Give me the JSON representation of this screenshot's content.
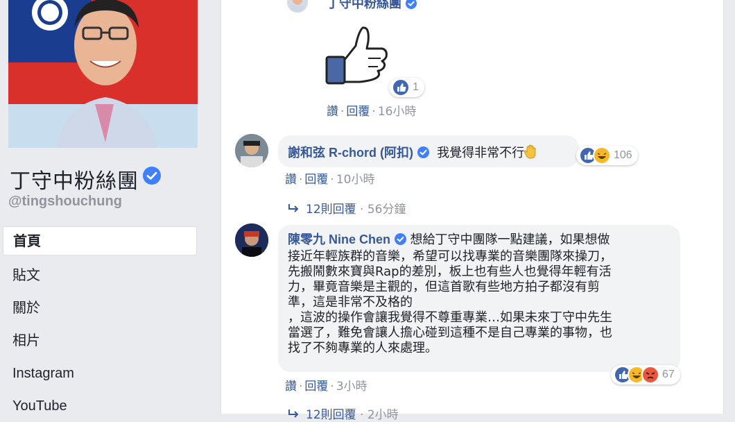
{
  "page": {
    "name": "丁守中粉絲團",
    "handle": "@tingshouchung"
  },
  "nav": {
    "items": [
      {
        "label": "首頁",
        "active": true
      },
      {
        "label": "貼文"
      },
      {
        "label": "關於"
      },
      {
        "label": "相片"
      },
      {
        "label": "Instagram"
      },
      {
        "label": "YouTube"
      }
    ]
  },
  "comments": {
    "top": {
      "author": "丁守中粉絲團",
      "sticker": "thumbs-up-sticker",
      "reaction_count": "1",
      "like": "讚",
      "reply": "回覆",
      "time": "16小時"
    },
    "c1": {
      "author": "謝和弦 R-chord (阿扣)",
      "text": "我覺得非常不行",
      "reaction_count": "106",
      "like": "讚",
      "reply": "回覆",
      "time": "10小時",
      "replies": "12則回覆",
      "replies_time": "56分鐘"
    },
    "c2": {
      "author": "陳零九 Nine Chen",
      "lines": [
        "想給丁守中團隊一點建議，如果想做",
        "接近年輕族群的音樂，希望可以找專業的音樂團隊來操刀，",
        "先搬鬧數來寶與Rap的差別，板上也有些人也覺得年輕有活",
        "力，畢竟音樂是主觀的，但這首歌有些地方拍子都沒有剪",
        "準，這是非常不及格的",
        "，這波的操作會讓我覺得不尊重專業…如果未來丁守中先生",
        "當選了，難免會讓人擔心碰到這種不是自己專業的事物，也",
        "找了不夠專業的人來處理。"
      ],
      "reaction_count": "67",
      "like": "讚",
      "reply": "回覆",
      "time": "3小時",
      "replies": "12則回覆",
      "replies_time": "2小時"
    }
  },
  "colors": {
    "link": "#365899",
    "meta": "#90949c",
    "bubble": "#f2f3f5",
    "like_blue": "#4267b2",
    "haha_yellow": "#f7b928",
    "angry_red": "#e9573e"
  }
}
